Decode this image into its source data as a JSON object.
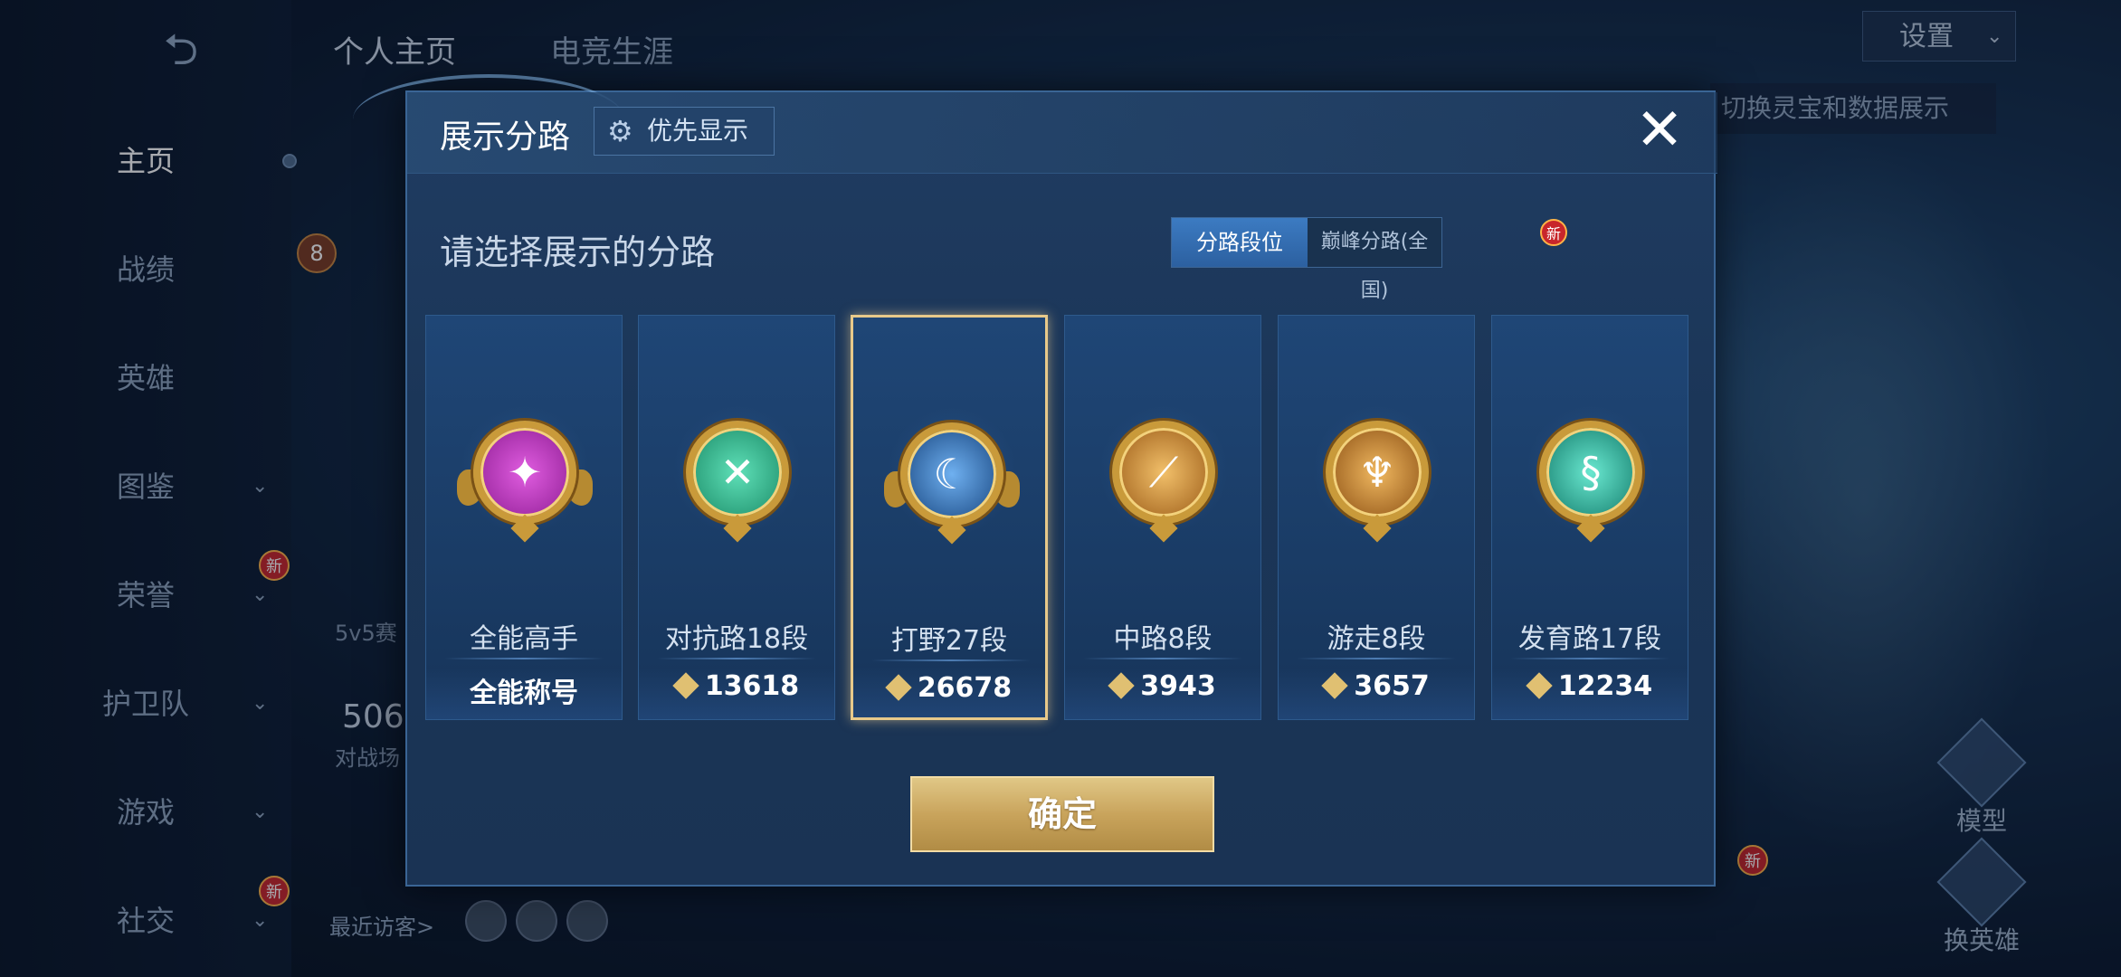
{
  "colors": {
    "gold": "#e0c786",
    "accent_blue": "#3c7bc2",
    "badge_red": "#c8262b",
    "emblem_jungle": "#2b6fc4",
    "emblem_all": "#b42fb6",
    "emblem_top": "#2fb38a",
    "emblem_mid": "#d99a3a",
    "emblem_roam": "#c98a2e",
    "emblem_adc": "#2fb8a0"
  },
  "background": {
    "back_icon": "back-arrow-icon",
    "tabs": [
      "个人主页",
      "电竞生涯"
    ],
    "sidebar": [
      {
        "label": "主页",
        "active": true
      },
      {
        "label": "战绩"
      },
      {
        "label": "英雄"
      },
      {
        "label": "图鉴",
        "chevron": true
      },
      {
        "label": "荣誉",
        "chevron": true,
        "badge": "新"
      },
      {
        "label": "护卫队",
        "chevron": true
      },
      {
        "label": "游戏",
        "chevron": true
      },
      {
        "label": "社交",
        "chevron": true,
        "badge": "新"
      }
    ],
    "level_badge": "8",
    "mode_text": "5v5赛",
    "count_text": "506",
    "count_label": "对战场",
    "recent_visitors_label": "最近访客>",
    "settings_label": "设置",
    "switch_hint": "切换灵宝和数据展示",
    "model_label": "模型",
    "change_hero_label": "换英雄",
    "right_new_badge": "新"
  },
  "modal": {
    "title": "展示分路",
    "priority_button": "优先显示",
    "priority_icon": "gear-icon",
    "close_icon": "close-icon",
    "prompt": "请选择展示的分路",
    "tabs": [
      {
        "label": "分路段位",
        "active": true
      },
      {
        "label": "巅峰分路(全国)",
        "badge": "新"
      }
    ],
    "cards": [
      {
        "lane": "全能高手",
        "value": "全能称号",
        "icon": "all-round-emblem-icon",
        "has_score_icon": false,
        "selected": false
      },
      {
        "lane": "对抗路18段",
        "value": "13618",
        "icon": "top-lane-emblem-icon",
        "has_score_icon": true,
        "selected": false
      },
      {
        "lane": "打野27段",
        "value": "26678",
        "icon": "jungle-emblem-icon",
        "has_score_icon": true,
        "selected": true
      },
      {
        "lane": "中路8段",
        "value": "3943",
        "icon": "mid-lane-emblem-icon",
        "has_score_icon": true,
        "selected": false
      },
      {
        "lane": "游走8段",
        "value": "3657",
        "icon": "roam-emblem-icon",
        "has_score_icon": true,
        "selected": false
      },
      {
        "lane": "发育路17段",
        "value": "12234",
        "icon": "farm-lane-emblem-icon",
        "has_score_icon": true,
        "selected": false
      }
    ],
    "confirm_button": "确定"
  }
}
